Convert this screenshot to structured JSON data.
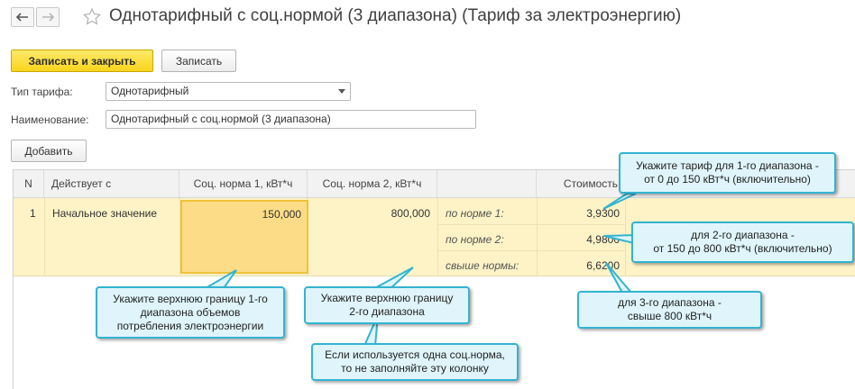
{
  "window": {
    "title": "Однотарифный с соц.нормой (3 диапазона) (Тариф за электроэнергию)"
  },
  "toolbar": {
    "save_close_label": "Записать и закрыть",
    "save_label": "Записать",
    "add_label": "Добавить"
  },
  "form": {
    "tariff_type_label": "Тип тарифа:",
    "tariff_type_value": "Однотарифный",
    "name_label": "Наименование:",
    "name_value": "Однотарифный с соц.нормой (3 диапазона)"
  },
  "table": {
    "columns": [
      "N",
      "Действует с",
      "Соц. норма 1, кВт*ч",
      "Соц. норма 2, кВт*ч",
      "",
      "Стоимость"
    ],
    "row": {
      "n": "1",
      "effective_from": "Начальное значение",
      "norm1": "150,000",
      "norm2": "800,000",
      "bands": [
        {
          "label": "по норме 1:",
          "cost": "3,9300"
        },
        {
          "label": "по норме 2:",
          "cost": "4,9800"
        },
        {
          "label": "свыше нормы:",
          "cost": "6,6200"
        }
      ]
    }
  },
  "callouts": {
    "range1": [
      "Укажите тариф для 1-го диапазона -",
      "от 0 до 150 кВт*ч (включительно)"
    ],
    "range2": [
      "для 2-го диапазона -",
      "от 150 до 800 кВт*ч (включительно)"
    ],
    "range3": [
      "для 3-го диапазона -",
      "свыше 800 кВт*ч"
    ],
    "upper1": [
      "Укажите верхнюю границу 1-го",
      "диапазона объемов",
      "потребления электроэнергии"
    ],
    "upper2": [
      "Укажите верхнюю границу",
      "2-го диапазона"
    ],
    "single_norm": [
      "Если используется одна соц.норма,",
      "то не заполняйте эту колонку"
    ]
  },
  "colors": {
    "primary_button": "#f8d51a",
    "row_highlight": "#fdf3c7",
    "edit_cell": "#fcdc86",
    "callout_bg": "#dff5fb",
    "callout_border": "#33b3d1"
  }
}
